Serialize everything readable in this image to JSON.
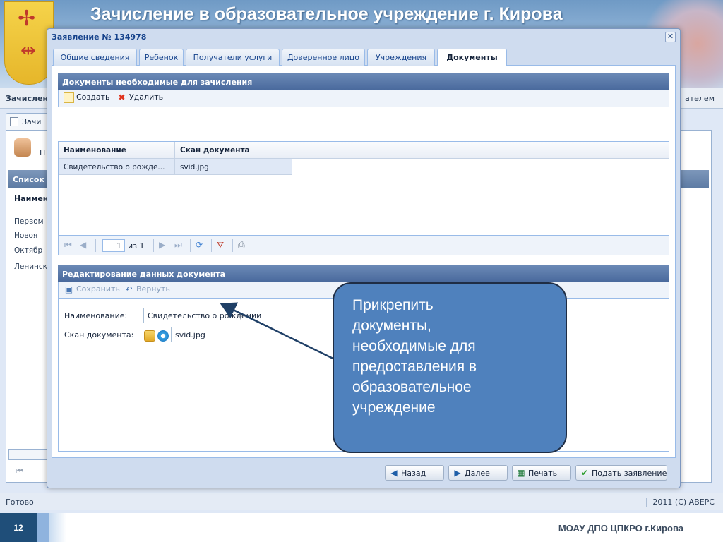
{
  "app": {
    "title": "Зачисление в образовательное учреждение г. Кирова",
    "subbar_left": "Зачислен",
    "subbar_right": "ателем",
    "tab_label": "Зачи",
    "toolbar_partial": "П",
    "list_header": "Список",
    "col_header": "Наимен",
    "rows": [
      "Первом",
      "Новоя",
      "Октябр",
      "Ленинск"
    ],
    "status_left": "Готово",
    "status_right": "2011 (C) АВЕРС"
  },
  "modal": {
    "title": "Заявление № 134978",
    "close_glyph": "✕",
    "tabs": [
      {
        "label": "Общие сведения",
        "active": false
      },
      {
        "label": "Ребенок",
        "active": false
      },
      {
        "label": "Получатели услуги",
        "active": false
      },
      {
        "label": "Доверенное лицо",
        "active": false
      },
      {
        "label": "Учреждения",
        "active": false
      },
      {
        "label": "Документы",
        "active": true
      }
    ],
    "documents_panel": {
      "header": "Документы необходимые для зачисления",
      "create_label": "Создать",
      "delete_label": "Удалить",
      "columns": [
        "Наименование",
        "Скан документа"
      ],
      "rows": [
        {
          "name": "Свидетельство о рожде...",
          "scan": "svid.jpg"
        }
      ],
      "pager": {
        "page": "1",
        "of_text": "из 1"
      }
    },
    "edit_panel": {
      "header": "Редактирование данных документа",
      "save_label": "Сохранить",
      "revert_label": "Вернуть",
      "name_label": "Наименование:",
      "name_value": "Свидетельство о рождении",
      "scan_label": "Скан документа:",
      "scan_value": "svid.jpg"
    },
    "buttons": {
      "back": "Назад",
      "next": "Далее",
      "print": "Печать",
      "submit": "Подать заявление"
    }
  },
  "callout": {
    "text": "Прикрепить\nдокументы,\nнеобходимые  для\nпредоставления в\nобразовательное\nучреждение"
  },
  "slide": {
    "number": "12",
    "org": "МОАУ ДПО ЦПКРО г.Кирова"
  },
  "colors": {
    "panel_header": "#4a6a9d",
    "callout_fill": "#4f81bd",
    "slide_number_bg": "#1f4e79",
    "selected_row": "#dfe8f6"
  }
}
